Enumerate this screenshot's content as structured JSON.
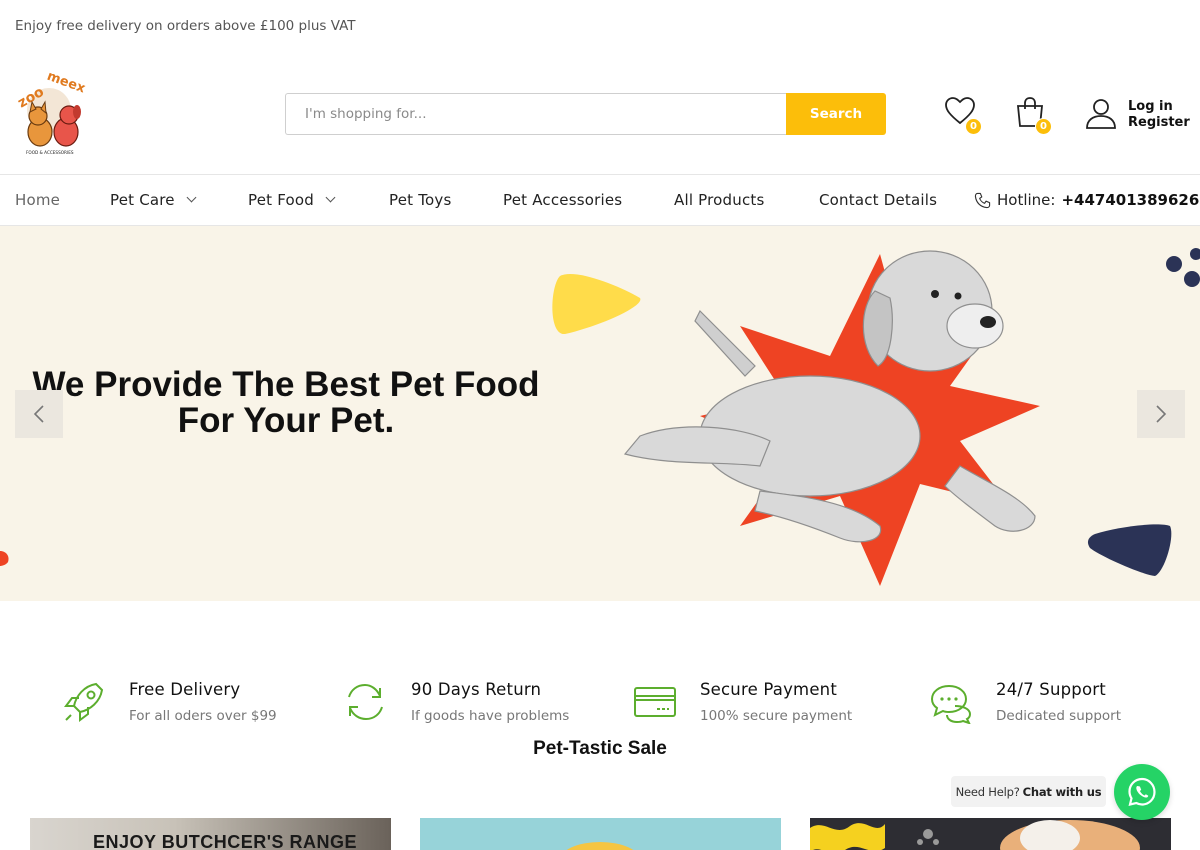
{
  "topbar": {
    "text": "Enjoy free delivery on orders above £100 plus VAT"
  },
  "header": {
    "logo": {
      "name": "zoomeex-logo",
      "tagline": "FOOD & ACCESSORIES"
    },
    "search": {
      "placeholder": "I'm shopping for...",
      "button_label": "Search"
    },
    "wishlist": {
      "icon": "heart-icon",
      "count": "0"
    },
    "cart": {
      "icon": "shopping-bag-icon",
      "count": "0"
    },
    "account": {
      "icon": "user-icon",
      "login_label": "Log in",
      "register_label": "Register"
    }
  },
  "nav": {
    "items": [
      {
        "label": "Home",
        "dropdown": false
      },
      {
        "label": "Pet Care",
        "dropdown": true
      },
      {
        "label": "Pet Food",
        "dropdown": true
      },
      {
        "label": "Pet Toys",
        "dropdown": false
      },
      {
        "label": "Pet Accessories",
        "dropdown": false
      },
      {
        "label": "All Products",
        "dropdown": false
      },
      {
        "label": "Contact Details",
        "dropdown": false
      }
    ],
    "hotline": {
      "icon": "phone-icon",
      "label": "Hotline:",
      "number": "+447401389626"
    }
  },
  "hero": {
    "headline_line1": "We Provide The Best Pet Food",
    "headline_line2": "For Your Pet.",
    "image": "puppy-on-red-starburst",
    "prev_icon": "chevron-left-icon",
    "next_icon": "chevron-right-icon"
  },
  "features": [
    {
      "icon": "rocket-icon",
      "title": "Free Delivery",
      "subtitle": "For all oders over $99"
    },
    {
      "icon": "refresh-icon",
      "title": "90 Days Return",
      "subtitle": "If goods have problems"
    },
    {
      "icon": "credit-card-icon",
      "title": "Secure Payment",
      "subtitle": "100% secure payment"
    },
    {
      "icon": "chat-icon",
      "title": "24/7 Support",
      "subtitle": "Dedicated support"
    }
  ],
  "sale_section": {
    "title": "Pet-Tastic Sale",
    "cards": [
      {
        "title": "ENJOY BUTCHCER'S RANGE"
      },
      {
        "title": ""
      },
      {
        "title": ""
      }
    ]
  },
  "whatsapp": {
    "help_text": "Need Help?",
    "chat_label": "Chat with us",
    "icon": "whatsapp-icon"
  },
  "colors": {
    "accent": "#fcbe0a",
    "hero_bg": "#f9f4e8",
    "feature_icon": "#5cae2e",
    "whatsapp": "#25d366",
    "starburst": "#ee4323",
    "navy_blob": "#2b3356"
  }
}
